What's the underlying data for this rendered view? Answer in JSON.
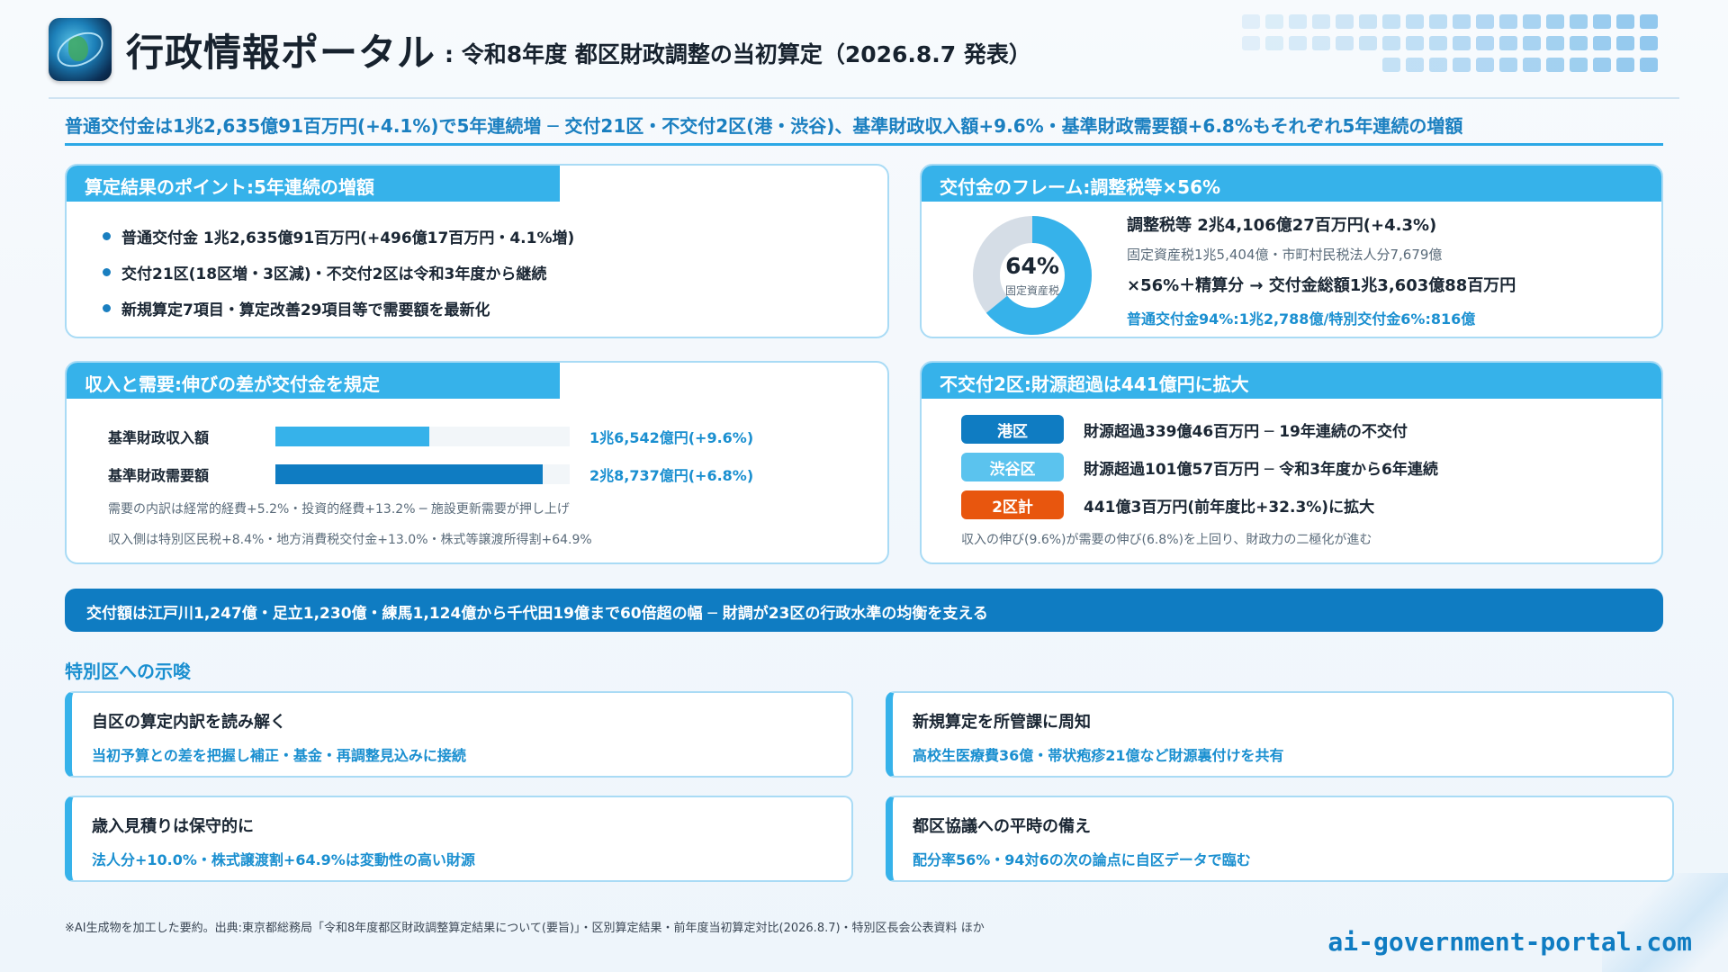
{
  "header": {
    "title": "行政情報ポータル",
    "subtitle": ": 令和8年度 都区財政調整の当初算定（2026.8.7 発表）"
  },
  "headline": "普通交付金は1兆2,635億91百万円(+4.1%)で5年連続増 ─ 交付21区・不交付2区(港・渋谷)、基準財政収入額+9.6%・基準財政需要額+6.8%もそれぞれ5年連続の増額",
  "points": {
    "tab": "算定結果のポイント:5年連続の増額",
    "items": [
      "普通交付金 1兆2,635億91百万円(+496億17百万円・4.1%増)",
      "交付21区(18区増・3区減)・不交付2区は令和3年度から継続",
      "新規算定7項目・算定改善29項目等で需要額を最新化"
    ]
  },
  "frame": {
    "tab": "交付金のフレーム:調整税等×56%",
    "donut_percent": 64,
    "donut_pct_label": "64%",
    "donut_label": "固定資産税",
    "line1": "調整税等 2兆4,106億27百万円(+4.3%)",
    "line2": "固定資産税1兆5,404億・市町村民税法人分7,679億",
    "line3": "×56%＋精算分 → 交付金総額1兆3,603億88百万円",
    "line4": "普通交付金94%:1兆2,788億/特別交付金6%:816億",
    "colors": {
      "fill": "#36b2ea",
      "rest": "#d5dde6"
    }
  },
  "income": {
    "tab": "収入と需要:伸びの差が交付金を規定",
    "bars": [
      {
        "label": "基準財政収入額",
        "value": 16542,
        "value_label": "1兆6,542億円(+9.6%)",
        "color": "#36b2ea"
      },
      {
        "label": "基準財政需要額",
        "value": 28737,
        "value_label": "2兆8,737億円(+6.8%)",
        "color": "#0f7cc2"
      }
    ],
    "note1": "需要の内訳は経常的経費+5.2%・投資的経費+13.2% ─ 施設更新需要が押し上げ",
    "note2": "収入側は特別区民税+8.4%・地方消費税交付金+13.0%・株式等譲渡所得割+64.9%"
  },
  "nonGrant": {
    "tab": "不交付2区:財源超過は441億円に拡大",
    "rows": [
      {
        "pill": "港区",
        "text": "財源超過339億46百万円 ─ 19年連続の不交付",
        "color": "#0f7cc2"
      },
      {
        "pill": "渋谷区",
        "text": "財源超過101億57百万円 ─ 令和3年度から6年連続",
        "color": "#5bc3ee"
      },
      {
        "pill": "2区計",
        "text": "441億3百万円(前年度比+32.3%)に拡大",
        "color": "#e8560e"
      }
    ],
    "note": "収入の伸び(9.6%)が需要の伸び(6.8%)を上回り、財政力の二極化が進む"
  },
  "banner": "交付額は江戸川1,247億・足立1,230億・練馬1,124億から千代田19億まで60倍超の幅 ─ 財調が23区の行政水準の均衡を支える",
  "implications": {
    "title": "特別区への示唆",
    "cards": [
      {
        "title": "自区の算定内訳を読み解く",
        "sub": "当初予算との差を把握し補正・基金・再調整見込みに接続"
      },
      {
        "title": "新規算定を所管課に周知",
        "sub": "高校生医療費36億・帯状疱疹21億など財源裏付けを共有"
      },
      {
        "title": "歳入見積りは保守的に",
        "sub": "法人分+10.0%・株式譲渡割+64.9%は変動性の高い財源"
      },
      {
        "title": "都区協議への平時の備え",
        "sub": "配分率56%・94対6の次の論点に自区データで臨む"
      }
    ]
  },
  "footnote": "※AI生成物を加工した要約。出典:東京都総務局「令和8年度都区財政調整算定結果について(要旨)」・区別算定結果・前年度当初算定対比(2026.8.7)・特別区長会公表資料 ほか",
  "site": "ai-government-portal.com"
}
